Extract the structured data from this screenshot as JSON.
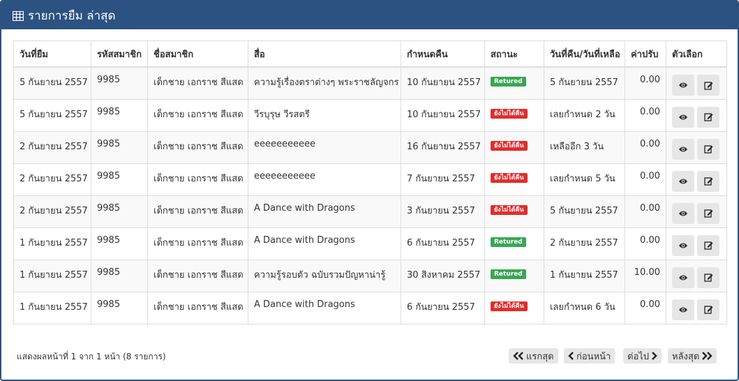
{
  "panel": {
    "title": "รายการยืม ล่าสุด",
    "title_icon": "table-icon"
  },
  "table": {
    "headers": [
      "วันที่ยืม",
      "รหัสสมาชิก",
      "ชื่อสมาชิก",
      "สื่อ",
      "กำหนดคืน",
      "สถานะ",
      "วันที่คืน/วันที่เหลือ",
      "ค่าปรับ",
      "ตัวเลือก"
    ],
    "rows": [
      {
        "borrow_date": "5 กันยายน 2557",
        "member_id": "9985",
        "member_name": "เด็กชาย เอกราช สีแสด",
        "media": "ความรู้เรื่องตราต่างๆ พระราชลัญจกร",
        "due_date": "10 กันยายน 2557",
        "status": "Retured",
        "status_color": "#3aa655",
        "return_info": "5 กันยายน 2557",
        "fine": "0.00"
      },
      {
        "borrow_date": "5 กันยายน 2557",
        "member_id": "9985",
        "member_name": "เด็กชาย เอกราช สีแสด",
        "media": "วีรบุรุษ วีรสตรี",
        "due_date": "10 กันยายน 2557",
        "status": "ยังไม่ได้คืน",
        "status_color": "#e02d2d",
        "return_info": "เลยกำหนด 2 วัน",
        "fine": "0.00"
      },
      {
        "borrow_date": "2 กันยายน 2557",
        "member_id": "9985",
        "member_name": "เด็กชาย เอกราช สีแสด",
        "media": "eeeeeeeeeee",
        "due_date": "16 กันยายน 2557",
        "status": "ยังไม่ได้คืน",
        "status_color": "#e02d2d",
        "return_info": "เหลืออีก 3 วัน",
        "fine": "0.00"
      },
      {
        "borrow_date": "2 กันยายน 2557",
        "member_id": "9985",
        "member_name": "เด็กชาย เอกราช สีแสด",
        "media": "eeeeeeeeeee",
        "due_date": "7 กันยายน 2557",
        "status": "ยังไม่ได้คืน",
        "status_color": "#e02d2d",
        "return_info": "เลยกำหนด 5 วัน",
        "fine": "0.00"
      },
      {
        "borrow_date": "2 กันยายน 2557",
        "member_id": "9985",
        "member_name": "เด็กชาย เอกราช สีแสด",
        "media": "A Dance with Dragons",
        "due_date": "3 กันยายน 2557",
        "status": "ยังไม่ได้คืน",
        "status_color": "#e02d2d",
        "return_info": "5 กันยายน 2557",
        "fine": "0.00"
      },
      {
        "borrow_date": "1 กันยายน 2557",
        "member_id": "9985",
        "member_name": "เด็กชาย เอกราช สีแสด",
        "media": "A Dance with Dragons",
        "due_date": "6 กันยายน 2557",
        "status": "Retured",
        "status_color": "#3aa655",
        "return_info": "2 กันยายน 2557",
        "fine": "0.00"
      },
      {
        "borrow_date": "1 กันยายน 2557",
        "member_id": "9985",
        "member_name": "เด็กชาย เอกราช สีแสด",
        "media": "ความรู้รอบตัว ฉบับรวมปัญหาน่ารู้",
        "due_date": "30 สิงหาคม 2557",
        "status": "Retured",
        "status_color": "#3aa655",
        "return_info": "1 กันยายน 2557",
        "fine": "10.00"
      },
      {
        "borrow_date": "1 กันยายน 2557",
        "member_id": "9985",
        "member_name": "เด็กชาย เอกราช สีแสด",
        "media": "A Dance with Dragons",
        "due_date": "6 กันยายน 2557",
        "status": "ยังไม่ได้คืน",
        "status_color": "#e02d2d",
        "return_info": "เลยกำหนด 6 วัน",
        "fine": "0.00"
      }
    ],
    "row_actions": [
      {
        "name": "view-button",
        "icon": "eye-icon"
      },
      {
        "name": "edit-button",
        "icon": "edit-icon"
      }
    ]
  },
  "footer": {
    "info": "แสดงผลหน้าที่ 1 จาก 1 หน้า (8 รายการ)",
    "pagination": {
      "first_label": "แรกสุด",
      "prev_label": "ก่อนหน้า",
      "next_label": "ต่อไป",
      "last_label": "หลังสุด"
    }
  },
  "colors": {
    "header_bg": "#2c5282",
    "returned": "#3aa655",
    "not_returned": "#e02d2d"
  }
}
